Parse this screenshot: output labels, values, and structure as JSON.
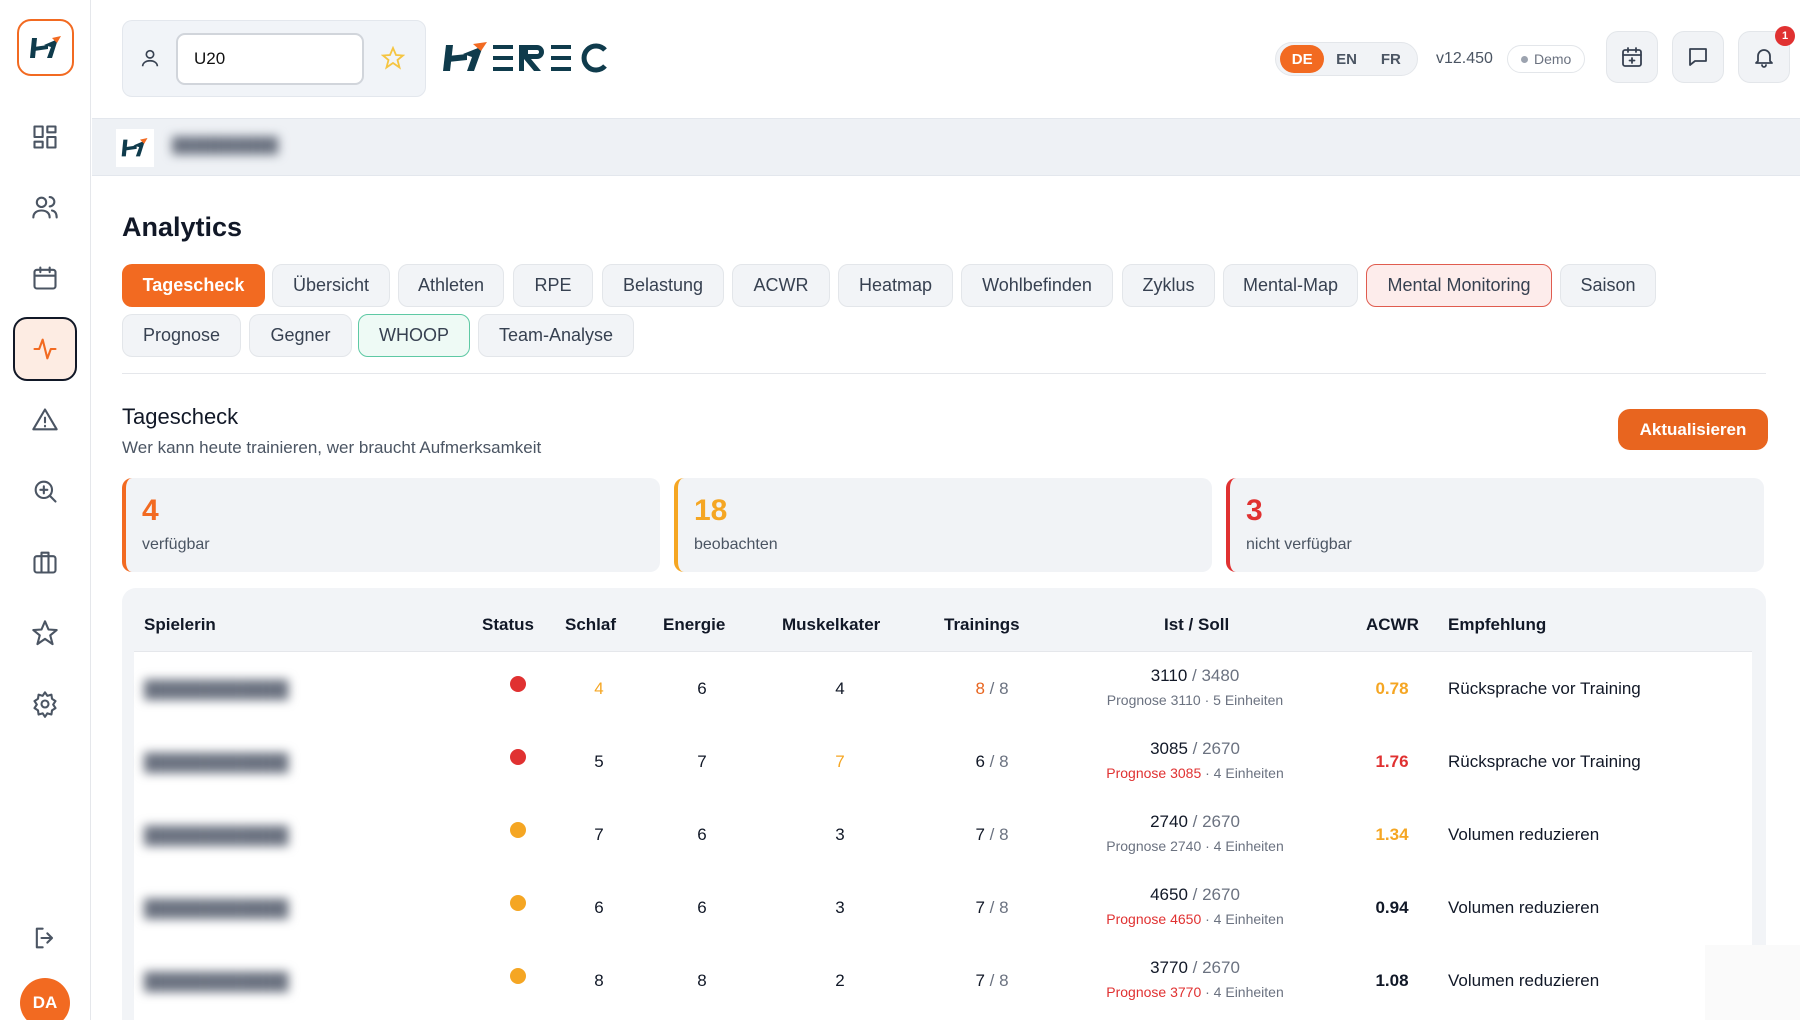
{
  "team": {
    "value": "U20"
  },
  "lang": {
    "de": "DE",
    "en": "EN",
    "fr": "FR"
  },
  "version": "v12.450",
  "demo": "Demo",
  "notifications": {
    "count": "1"
  },
  "avatar": "DA",
  "page": {
    "title": "Analytics"
  },
  "tabs": [
    {
      "label": "Tagescheck"
    },
    {
      "label": "Übersicht"
    },
    {
      "label": "Athleten"
    },
    {
      "label": "RPE"
    },
    {
      "label": "Belastung"
    },
    {
      "label": "ACWR"
    },
    {
      "label": "Heatmap"
    },
    {
      "label": "Wohlbefinden"
    },
    {
      "label": "Zyklus"
    },
    {
      "label": "Mental-Map"
    },
    {
      "label": "Mental Monitoring"
    },
    {
      "label": "Saison"
    },
    {
      "label": "Prognose"
    },
    {
      "label": "Gegner"
    },
    {
      "label": "WHOOP"
    },
    {
      "label": "Team-Analyse"
    }
  ],
  "section": {
    "title": "Tagescheck",
    "subtitle": "Wer kann heute trainieren, wer braucht Aufmerksamkeit",
    "refresh": "Aktualisieren"
  },
  "stats": [
    {
      "value": "4",
      "label": "verfügbar",
      "color": "#f26a21"
    },
    {
      "value": "18",
      "label": "beobachten",
      "color": "#f5a623"
    },
    {
      "value": "3",
      "label": "nicht verfügbar",
      "color": "#e03131"
    }
  ],
  "table": {
    "headers": {
      "player": "Spielerin",
      "status": "Status",
      "sleep": "Schlaf",
      "energy": "Energie",
      "soreness": "Muskelkater",
      "trainings": "Trainings",
      "load": "Ist / Soll",
      "acwr": "ACWR",
      "recommendation": "Empfehlung"
    },
    "rows": [
      {
        "status": "#e03131",
        "sleep": "4",
        "energy": "6",
        "soreness": "4",
        "tr_done": "8",
        "tr_total": "/ 8",
        "ist": "3110",
        "soll": "/ 3480",
        "prognose": "Prognose 3110",
        "units": "· 5 Einheiten",
        "acwr": "0.78",
        "rec": "Rücksprache vor Training"
      },
      {
        "status": "#e03131",
        "sleep": "5",
        "energy": "7",
        "soreness": "7",
        "tr_done": "6",
        "tr_total": "/ 8",
        "ist": "3085",
        "soll": "/ 2670",
        "prognose": "Prognose 3085",
        "units": "· 4 Einheiten",
        "acwr": "1.76",
        "rec": "Rücksprache vor Training"
      },
      {
        "status": "#f5a623",
        "sleep": "7",
        "energy": "6",
        "soreness": "3",
        "tr_done": "7",
        "tr_total": "/ 8",
        "ist": "2740",
        "soll": "/ 2670",
        "prognose": "Prognose 2740",
        "units": "· 4 Einheiten",
        "acwr": "1.34",
        "rec": "Volumen reduzieren"
      },
      {
        "status": "#f5a623",
        "sleep": "6",
        "energy": "6",
        "soreness": "3",
        "tr_done": "7",
        "tr_total": "/ 8",
        "ist": "4650",
        "soll": "/ 2670",
        "prognose": "Prognose 4650",
        "units": "· 4 Einheiten",
        "acwr": "0.94",
        "rec": "Volumen reduzieren"
      },
      {
        "status": "#f5a623",
        "sleep": "8",
        "energy": "8",
        "soreness": "2",
        "tr_done": "7",
        "tr_total": "/ 8",
        "ist": "3770",
        "soll": "/ 2670",
        "prognose": "Prognose 3770",
        "units": "· 4 Einheiten",
        "acwr": "1.08",
        "rec": "Volumen reduzieren"
      }
    ]
  }
}
